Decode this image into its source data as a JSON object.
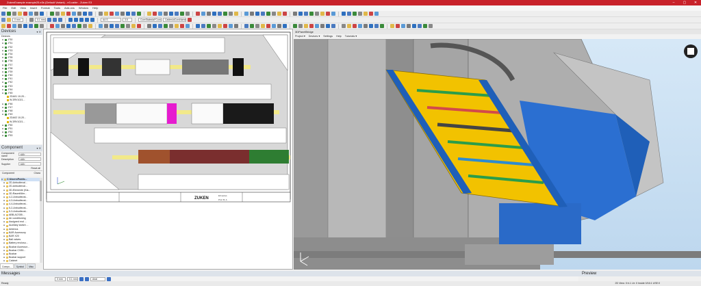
{
  "window": {
    "title": "ZukenExample example25.e3s (Default Variant) - e3.cable - Zuken E3",
    "minimize": "–",
    "maximize": "▢",
    "close": "✕"
  },
  "menu": [
    "File",
    "Edit",
    "View",
    "Insert",
    "Format",
    "Tools",
    "Add-ons",
    "Window",
    "Help"
  ],
  "toolbar": {
    "zoom_value": "0 mm",
    "line_width": "0.1 mm",
    "sheet_select": "A4 S",
    "font_name": "Arial",
    "font_size": "3.5",
    "view_mode": "CoreStatesIsFCompp",
    "layer": "CablesIdCorsName"
  },
  "devices_panel": {
    "title": "Devices",
    "root": "Devices",
    "items": [
      "-F30",
      "-F31",
      "-F32",
      "-F33",
      "-F34",
      "-F35",
      "-F36",
      "-F37",
      "-F38",
      "-F39",
      "-F40",
      "-F41",
      "-F42",
      "-F43",
      "-F44",
      "-F45",
      "-F46",
      "-F47",
      "-F48",
      "-F49",
      "-F50",
      "-F51",
      "-F52",
      "-F53"
    ],
    "special_items": [
      "2DA01 10-20...",
      "W-3RV1021...",
      "2DA02 10-20...",
      "W-3RV1021..."
    ]
  },
  "component_panel": {
    "title": "Component",
    "fields": [
      {
        "label": "Component name",
        "value": "<All>"
      },
      {
        "label": "Description",
        "value": "<All>"
      },
      {
        "label": "Supplier",
        "value": "<All>"
      }
    ],
    "reset_label": "Reset all",
    "col_component": "Component",
    "col_charact": "Chara",
    "root": "C:\\Users\\Public...",
    "items": [
      "2D-Anbudteval...",
      "2D-Anbudteval...",
      "3D-Elemente (Kla...",
      "3D-Raumfüller...",
      "4-2-Anbudteval...",
      "4-3-Anbudteval...",
      "4-4-Anbudteval...",
      "5-2-Anbudteval...",
      "5-3-Anbudteval...",
      "ABB-ACS55...",
      "Air conditioning",
      "Assigned end ...",
      "Auxiliary switch ...",
      "Antenna",
      "B&R Accessory",
      "B&R X20",
      "Ball valves",
      "Battery enclosu...",
      "Busbar Accessor...",
      "Busbar CV50...",
      "Busbar",
      "Busbar support",
      "Cabinet",
      "Cabinet - enclo...",
      "Cabinet - enclo...",
      "Cable duct"
    ]
  },
  "bottom_tabs": [
    "Compo...",
    "Symbol",
    "Misc"
  ],
  "schematic": {
    "title_block_logo": "ZUKEN",
    "sheet_number": "E3.series",
    "page": "Prof. B, A"
  },
  "view3d": {
    "title": "3DPanelBridge",
    "menu": [
      "Project ▾",
      "Devices ▾",
      "Settings",
      "Help",
      "Tutorials ▾"
    ]
  },
  "messages": {
    "title": "Messages",
    "font": "Arial",
    "size": "0 mm",
    "line": "0.1 mm"
  },
  "preview": {
    "title": "Preview"
  },
  "status": {
    "left": "Ready",
    "right": "2D View: 0:h.1  Ltr: 0  Inside 0/16:1  USE:0"
  }
}
